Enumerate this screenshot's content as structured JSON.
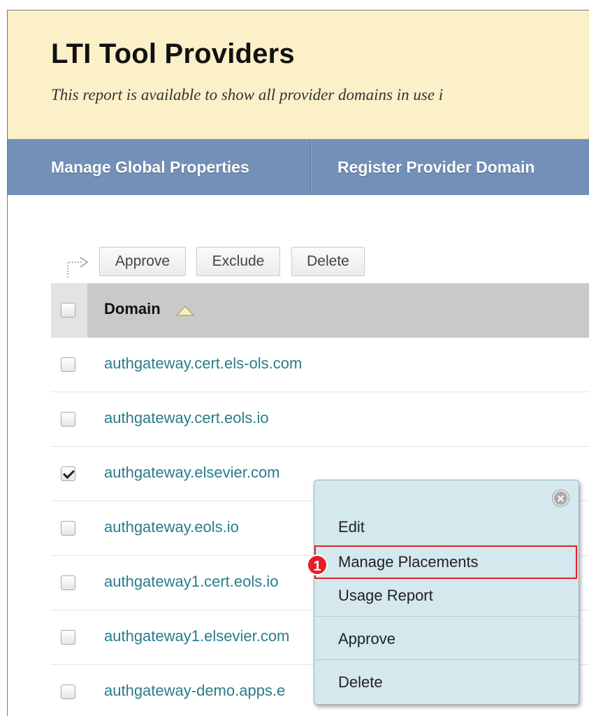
{
  "header": {
    "title": "LTI Tool Providers",
    "description": "This report is available to show all provider domains in use i"
  },
  "action_bar": {
    "manage_global": "Manage Global Properties",
    "register_domain": "Register Provider Domain"
  },
  "toolbar": {
    "approve": "Approve",
    "exclude": "Exclude",
    "delete": "Delete"
  },
  "table": {
    "column_domain": "Domain",
    "rows": [
      {
        "domain": "authgateway.cert.els-ols.com",
        "checked": false
      },
      {
        "domain": "authgateway.cert.eols.io",
        "checked": false
      },
      {
        "domain": "authgateway.elsevier.com",
        "checked": true
      },
      {
        "domain": "authgateway.eols.io",
        "checked": false
      },
      {
        "domain": "authgateway1.cert.eols.io",
        "checked": false
      },
      {
        "domain": "authgateway1.elsevier.com",
        "checked": false
      },
      {
        "domain": "authgateway-demo.apps.e",
        "checked": false
      }
    ]
  },
  "context_menu": {
    "items": [
      "Edit",
      "Manage Placements",
      "Usage Report",
      "Approve",
      "Delete"
    ],
    "highlighted_item": "Manage Placements",
    "callout_number": "1"
  },
  "colors": {
    "header_bg": "#fcf0c8",
    "action_bar_bg": "#7390b8",
    "link": "#2a7c8a",
    "menu_bg": "#d4e8ee",
    "highlight": "#e41e26"
  },
  "icons": [
    "select-all-arrow-icon",
    "sort-ascending-icon",
    "close-icon",
    "checkbox-icon"
  ]
}
